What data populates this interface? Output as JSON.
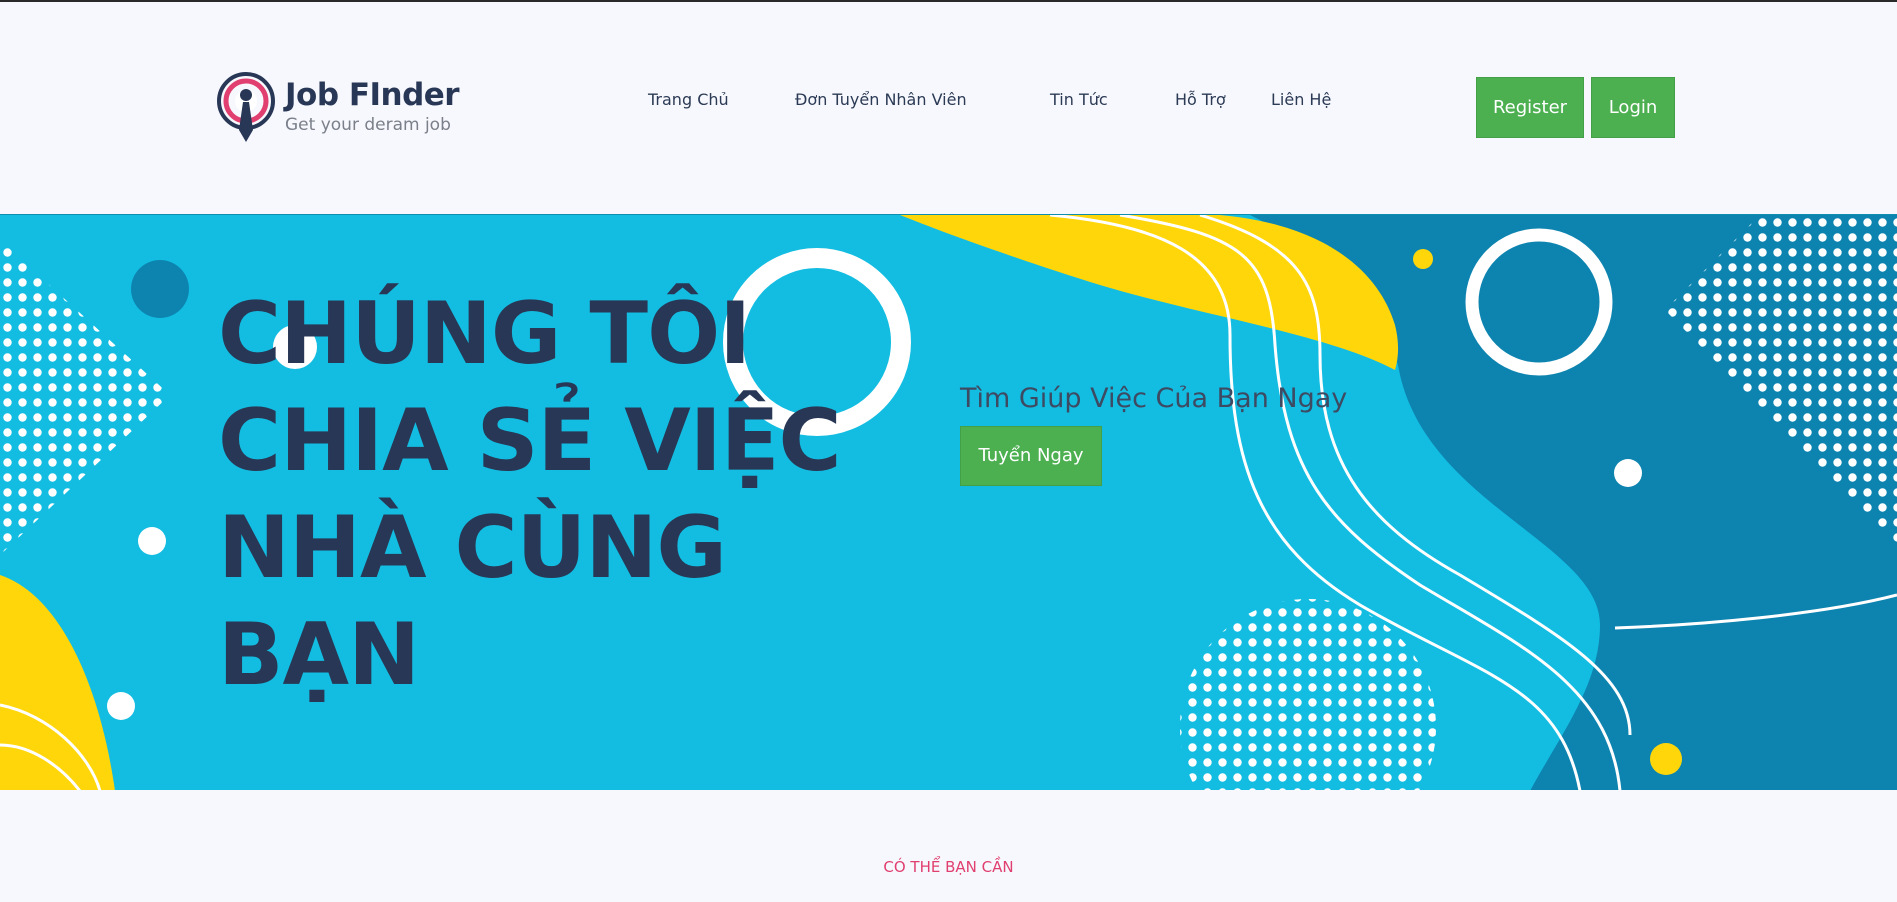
{
  "header": {
    "logo": {
      "title": "Job FInder",
      "tagline": "Get your deram job",
      "icon": "job-finder-logo-icon"
    },
    "nav": [
      {
        "label": "Trang Chủ"
      },
      {
        "label": "Đơn Tuyển Nhân Viên"
      },
      {
        "label": "Tin Tức"
      },
      {
        "label": "Hỗ Trợ"
      },
      {
        "label": "Liên Hệ"
      }
    ],
    "register_label": "Register",
    "login_label": "Login"
  },
  "hero": {
    "title": "CHÚNG TÔI CHIA SẺ VIỆC NHÀ CÙNG BẠN",
    "subtitle": "Tìm Giúp Việc Của Bạn Ngay",
    "cta_label": "Tuyển Ngay"
  },
  "section": {
    "kicker": "CÓ THỂ BẠN CẦN"
  },
  "colors": {
    "page_bg": "#f7f8fd",
    "brand_dark": "#283755",
    "brand_pink": "#e03f6f",
    "button_green": "#4caf50",
    "hero_cyan": "#13bde2",
    "hero_deep_blue": "#0d84b0",
    "hero_yellow": "#ffd60a"
  }
}
